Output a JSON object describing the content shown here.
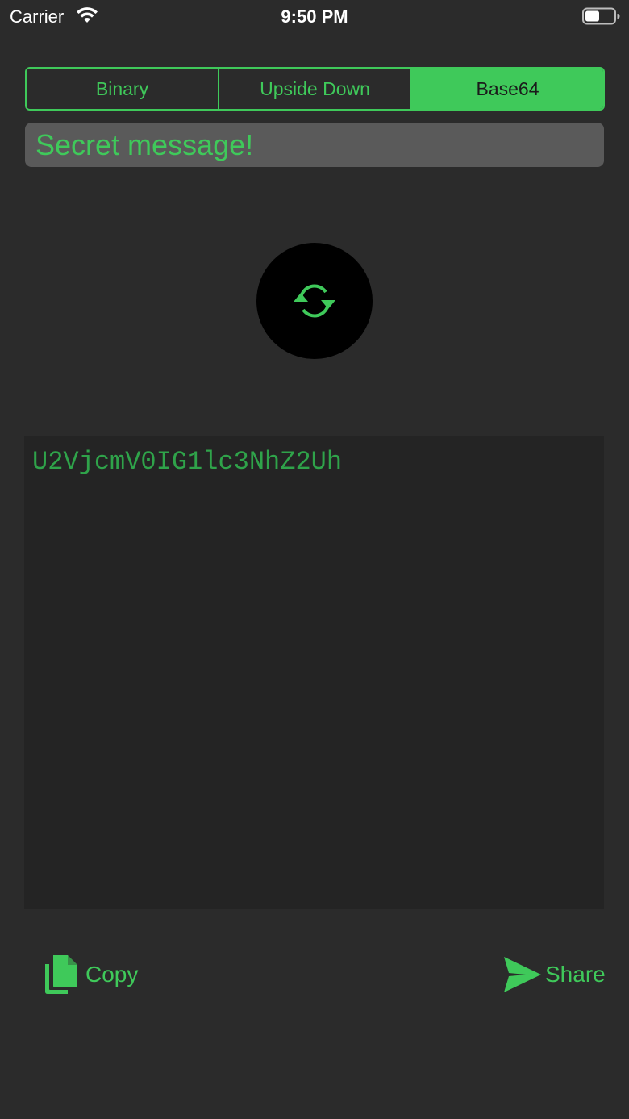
{
  "status_bar": {
    "carrier": "Carrier",
    "time": "9:50 PM",
    "wifi_icon": "wifi-icon",
    "battery_icon": "battery-icon"
  },
  "segments": [
    {
      "label": "Binary",
      "selected": false
    },
    {
      "label": "Upside Down",
      "selected": false
    },
    {
      "label": "Base64",
      "selected": true
    }
  ],
  "input": {
    "value": "Secret message!"
  },
  "convert_button": {
    "icon": "refresh-icon"
  },
  "output": {
    "text": "U2VjcmV0IG1lc3NhZ2Uh"
  },
  "actions": {
    "copy_label": "Copy",
    "copy_icon": "copy-icon",
    "share_label": "Share",
    "share_icon": "send-icon"
  },
  "colors": {
    "accent": "#3fc95a",
    "background": "#2b2b2b",
    "input_background": "#5a5a5a",
    "output_background": "#242424",
    "output_text": "#2fa34a"
  }
}
